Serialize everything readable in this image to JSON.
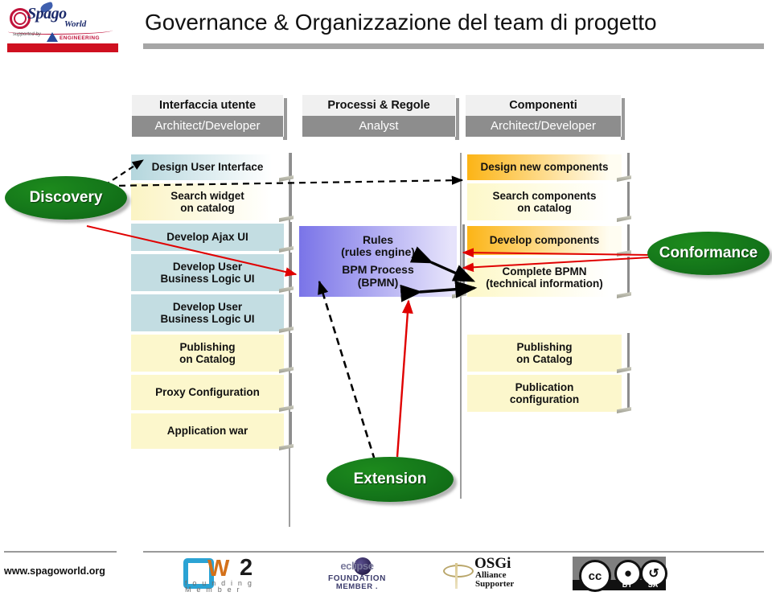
{
  "brand": {
    "logo_name": "Spago",
    "logo_suffix": "World",
    "supported_by": "supported by",
    "partner": "ENGINEERING"
  },
  "header": {
    "title": "Governance & Organizzazione del team  di progetto"
  },
  "columns": [
    {
      "id": "ui",
      "role_title": "Interfaccia utente",
      "role_actor": "Architect/Developer"
    },
    {
      "id": "processes",
      "role_title": "Processi & Regole",
      "role_actor": "Analyst"
    },
    {
      "id": "components",
      "role_title": "Componenti",
      "role_actor": "Architect/Developer"
    }
  ],
  "left_column_steps": [
    {
      "label": "Design User Interface"
    },
    {
      "label": "Search widget\non catalog"
    },
    {
      "label": "Develop Ajax UI"
    },
    {
      "label": "Develop User\nBusiness Logic UI"
    },
    {
      "label": "Develop User\nBusiness Logic UI"
    },
    {
      "label": "Publishing\non Catalog"
    },
    {
      "label": "Proxy Configuration"
    },
    {
      "label": "Application war"
    }
  ],
  "middle_column_box": {
    "line1": "Rules",
    "line2": "(rules engine)",
    "line3": "BPM Process",
    "line4": "(BPMN)"
  },
  "right_column_steps": [
    {
      "label": "Design new components"
    },
    {
      "label": "Search components\non catalog"
    },
    {
      "label": "Develop components"
    },
    {
      "label": "Complete BPMN\n(technical information)"
    },
    {
      "label": "Publishing\non Catalog"
    },
    {
      "label": "Publication\nconfiguration"
    }
  ],
  "ovals": [
    {
      "id": "discovery",
      "label": "Discovery"
    },
    {
      "id": "conformance",
      "label": "Conformance"
    },
    {
      "id": "extension",
      "label": "Extension"
    }
  ],
  "footer": {
    "url": "www.spagoworld.org",
    "ow2": {
      "o": "O",
      "w": "W",
      "two": "2",
      "sub1": "f o u n d i n g",
      "sub2": "M e m b e r"
    },
    "eclipse": {
      "word": "eclipse",
      "line1": "FOUNDATION",
      "line2": "MEMBER ."
    },
    "osgi": {
      "name": "OSGi",
      "line1": "Alliance",
      "line2": "Supporter"
    },
    "cc": {
      "mark": "cc",
      "by_glyph": "\u0001",
      "sa_glyph": "↺",
      "by": "BY",
      "sa": "SA"
    }
  },
  "colors": {
    "accent_red": "#cf1020",
    "header_grey": "#8d8d8d",
    "oval_green": "#147619",
    "ui_blue": "#b4d6dd",
    "ui_yellow": "#fbf4c4",
    "mid_purple": "#7a74e8",
    "comp_orange": "#fcb415",
    "arrow_red": "#e00000"
  }
}
